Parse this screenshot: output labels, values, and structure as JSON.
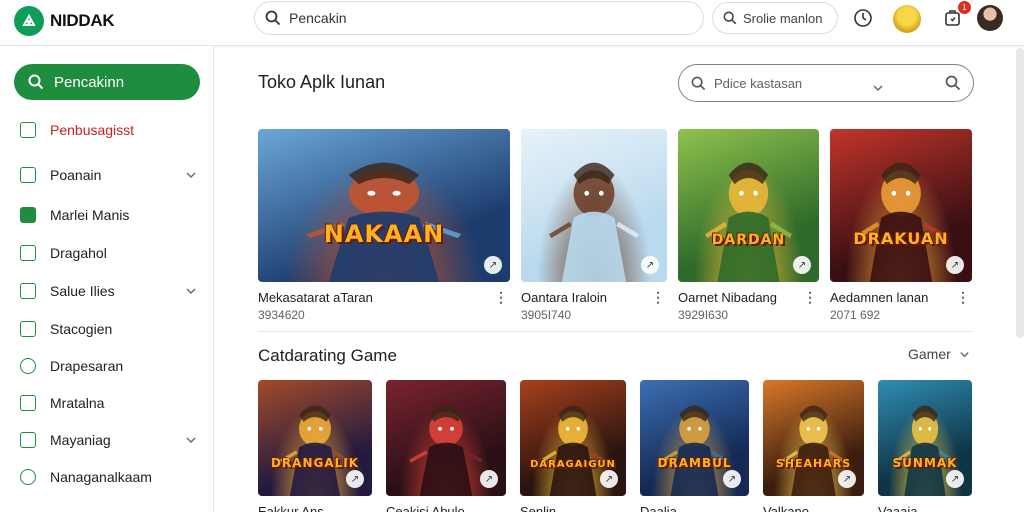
{
  "app": {
    "logo_text": "NIDDAK"
  },
  "topbar": {
    "search_value": "Pencakin",
    "search2_text": "Srolie manlon",
    "notif_badge": "1",
    "icons": [
      "search-icon",
      "history-icon",
      "notification-icon"
    ]
  },
  "sidebar": {
    "search_label": "Pencakinn",
    "items": [
      {
        "label": "Penbusagisst",
        "icon": "home-icon",
        "active": true,
        "chevron": false
      },
      {
        "label": "Poanain",
        "icon": "library-icon",
        "active": false,
        "chevron": true
      },
      {
        "label": "Marlei Manis",
        "icon": "games-icon",
        "active": false,
        "chevron": false
      },
      {
        "label": "Dragahol",
        "icon": "apps-icon",
        "active": false,
        "chevron": false
      },
      {
        "label": "Salue Ilies",
        "icon": "store-icon",
        "active": false,
        "chevron": true
      },
      {
        "label": "Stacogien",
        "icon": "chart-icon",
        "active": false,
        "chevron": false
      },
      {
        "label": "Drapesaran",
        "icon": "refresh-icon",
        "active": false,
        "chevron": false
      },
      {
        "label": "Mratalna",
        "icon": "bag-icon",
        "active": false,
        "chevron": false
      },
      {
        "label": "Mayaniag",
        "icon": "book-icon",
        "active": false,
        "chevron": true
      },
      {
        "label": "Nanaganalkaam",
        "icon": "circle-icon",
        "active": false,
        "chevron": false
      }
    ]
  },
  "main": {
    "section1_title": "Toko Aplk Iunan",
    "search_placeholder": "Pdice kastasan",
    "section2_title": "Catdarating Game",
    "section2_more": "Gamer",
    "row1": [
      {
        "name": "Mekasatarat aTaran",
        "meta": "3934620",
        "caption": "NAKAAN",
        "palette": [
          "#1d3c6e",
          "#6aa7d8",
          "#c9542a"
        ]
      },
      {
        "name": "Oantara Iraloin",
        "meta": "3905Ι740",
        "caption": "",
        "palette": [
          "#b8d9ee",
          "#e8f2fa",
          "#6b3a22"
        ]
      },
      {
        "name": "Oarnet Nibadang",
        "meta": "3929Ι630",
        "caption": "DARDAN",
        "palette": [
          "#2e6a2a",
          "#8fc24c",
          "#f1b93a"
        ]
      },
      {
        "name": "Aedamnen lanan",
        "meta": "2071 692",
        "caption": "DRAKUAN",
        "palette": [
          "#3a0f14",
          "#c2352a",
          "#f0a23a"
        ]
      }
    ],
    "row2": [
      {
        "name": "Eakkur Ans",
        "caption": "DRANGALIK",
        "palette": [
          "#241a40",
          "#a34a2a",
          "#f5b03a"
        ]
      },
      {
        "name": "Ceakisi Abulo",
        "caption": "",
        "palette": [
          "#2a1015",
          "#7a2330",
          "#e2443a"
        ]
      },
      {
        "name": "Senlin",
        "caption": "DARAGAIGUN",
        "palette": [
          "#2a1410",
          "#a8401c",
          "#f7c13a"
        ]
      },
      {
        "name": "Daalia",
        "caption": "DRAMBUL",
        "palette": [
          "#142a55",
          "#3d6fb3",
          "#e3a43c"
        ]
      },
      {
        "name": "Valkano",
        "caption": "SHEAHARS",
        "palette": [
          "#3c1e0e",
          "#d8782a",
          "#f4cc55"
        ]
      },
      {
        "name": "Vaaaja",
        "caption": "SUNMAK",
        "palette": [
          "#0f3545",
          "#2f8db3",
          "#f2c642"
        ]
      }
    ]
  }
}
